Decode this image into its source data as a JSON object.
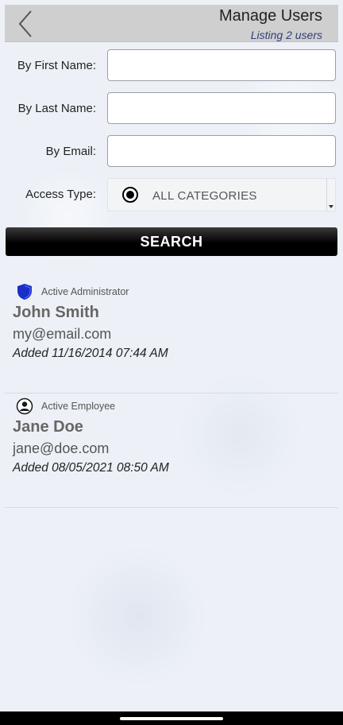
{
  "header": {
    "title": "Manage Users",
    "subtitle": "Listing 2 users",
    "back_icon": "chevron-left-icon"
  },
  "form": {
    "first_name_label": "By First Name:",
    "first_name_value": "",
    "last_name_label": "By Last Name:",
    "last_name_value": "",
    "email_label": "By Email:",
    "email_value": "",
    "access_type_label": "Access Type:",
    "access_type_value": "ALL CATEGORIES",
    "search_button_label": "SEARCH"
  },
  "users": [
    {
      "role": "Active Administrator",
      "role_icon": "shield-icon",
      "role_icon_color": "#1a2fc8",
      "name": "John Smith",
      "email": "my@email.com",
      "added": "Added 11/16/2014 07:44 AM"
    },
    {
      "role": "Active Employee",
      "role_icon": "person-icon",
      "role_icon_color": "#1a1a1a",
      "name": "Jane Doe",
      "email": "jane@doe.com",
      "added": "Added 08/05/2021 08:50 AM"
    }
  ]
}
